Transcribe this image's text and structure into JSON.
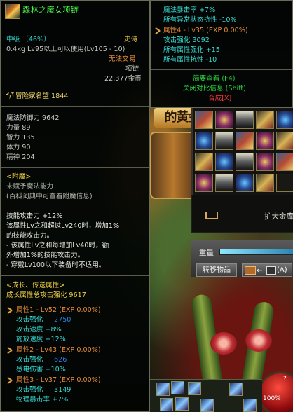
{
  "left_tooltip": {
    "item_name": "森林之魔女项链",
    "grade": "中级 （46%）",
    "rarity": "史诗",
    "weight_level": "0.4kg  Lv95以上可以使用(Lv105 - 10)",
    "trade": "无法交易",
    "item_type": "项链",
    "price": "22,377金币",
    "reputation": "冒险家名望 1844",
    "stats": {
      "magic_defense": "魔法防御力 9642",
      "strength": "力量 89",
      "intelligence": "智力 135",
      "vitality": "体力 90",
      "spirit": "精神 204"
    },
    "enchant": {
      "header": "<附魔>",
      "line_1": "未赋予魔法能力",
      "line_2": "(百科词典中可查看附魔信息)"
    },
    "skill_attack": {
      "line_1": "技能攻击力 +12%",
      "line_2": "该属性Lv之和超过Lv240时，增加1%",
      "line_3": "的技能攻击力。",
      "line_4": "- 该属性Lv之和每增加Lv40时，额",
      "line_5": "外增加1%的技能攻击力。",
      "line_6": "- 穿戴Lv100以下装备时不适用。"
    },
    "growth": {
      "header": "<成长、传送属性>",
      "total": "成长属性总攻击强化  9617",
      "attr_1": "属性1 - Lv52 (EXP 0.00%)",
      "attr_1_attack": "攻击强化",
      "attr_1_attack_value": "2750",
      "attr_1_speed": "攻击速度 +8%",
      "attr_1_cast": "施放速度 +12%",
      "attr_2": "属性2 - Lv43 (EXP 0.00%)",
      "attr_2_attack": "攻击强化",
      "attr_2_attack_value": "626",
      "attr_2_damage": "感电伤害 +10%",
      "attr_3": "属性3 - Lv37 (EXP 0.00%)",
      "attr_3_attack": "攻击强化",
      "attr_3_attack_value": "3149",
      "attr_3_crit": "物理暴击率 +7%"
    }
  },
  "right_tooltip": {
    "magic_crit": "魔法暴击率 +7%",
    "abnormal_resist": "所有异常状态抗性 -10%",
    "attr_4": "属性4 - Lv35 (EXP 0.00%)",
    "attr_4_attack": "攻击强化 3092",
    "all_element_boost": "所有属性强化 +15",
    "all_element_resist": "所有属性抗性 -10",
    "simple_view": "简要查看 (F4)",
    "close_compare": "关闭对比信息 (Shift)",
    "synthesis": "合成[X]"
  },
  "scene": {
    "banner_text": "的黄金",
    "expand_text": "扩大金库",
    "weight_label": "重量",
    "transfer_button": "转移物品",
    "swap_key": "(A)",
    "orb_percent": "100%",
    "minimap_mark": "?"
  },
  "colors": {
    "title": "#4dff4d",
    "gold": "#f0ce44",
    "green": "#2bd53f",
    "cyan": "#36d7d0",
    "orange": "#e58d38",
    "red": "#ff3b3b",
    "blue": "#2a84e8"
  }
}
